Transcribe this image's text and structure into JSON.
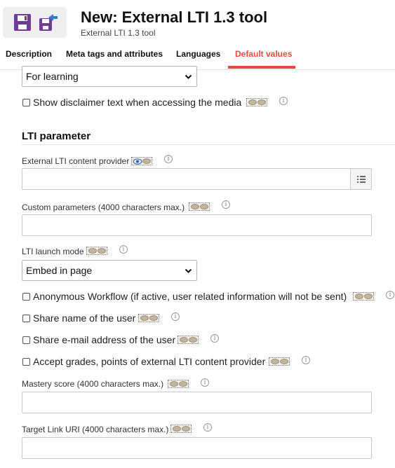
{
  "header": {
    "title": "New: External LTI 1.3 tool",
    "subtitle": "External LTI 1.3 tool",
    "icons": [
      "save-icon",
      "save-as-icon"
    ]
  },
  "tabs": [
    {
      "label": "Description",
      "active": false
    },
    {
      "label": "Meta tags and attributes",
      "active": false
    },
    {
      "label": "Languages",
      "active": false
    },
    {
      "label": "Default values",
      "active": true
    }
  ],
  "colors": {
    "accent": "#e8493c",
    "border": "#c8c8c8"
  },
  "form": {
    "usage_select": {
      "value": "For learning"
    },
    "disclaimer_checkbox": {
      "label": "Show disclaimer text when accessing the media",
      "checked": false
    },
    "lti_section_title": "LTI parameter",
    "content_provider": {
      "label": "External LTI content provider",
      "value": ""
    },
    "custom_parameters": {
      "label": "Custom parameters (4000 characters max.)",
      "value": ""
    },
    "launch_mode": {
      "label": "LTI launch mode",
      "value": "Embed in page"
    },
    "anonymous_workflow": {
      "label": "Anonymous Workflow (if active, user related information will not be sent)",
      "checked": false
    },
    "share_name": {
      "label": "Share name of the user",
      "checked": false
    },
    "share_email": {
      "label": "Share e-mail address of the user",
      "checked": false
    },
    "accept_grades": {
      "label": "Accept grades, points of external LTI content provider",
      "checked": false
    },
    "mastery_score": {
      "label": "Mastery score (4000 characters max.)",
      "value": ""
    },
    "target_link_uri": {
      "label": "Target Link URI (4000 characters max.)",
      "value": ""
    },
    "info_glyph": "i"
  }
}
